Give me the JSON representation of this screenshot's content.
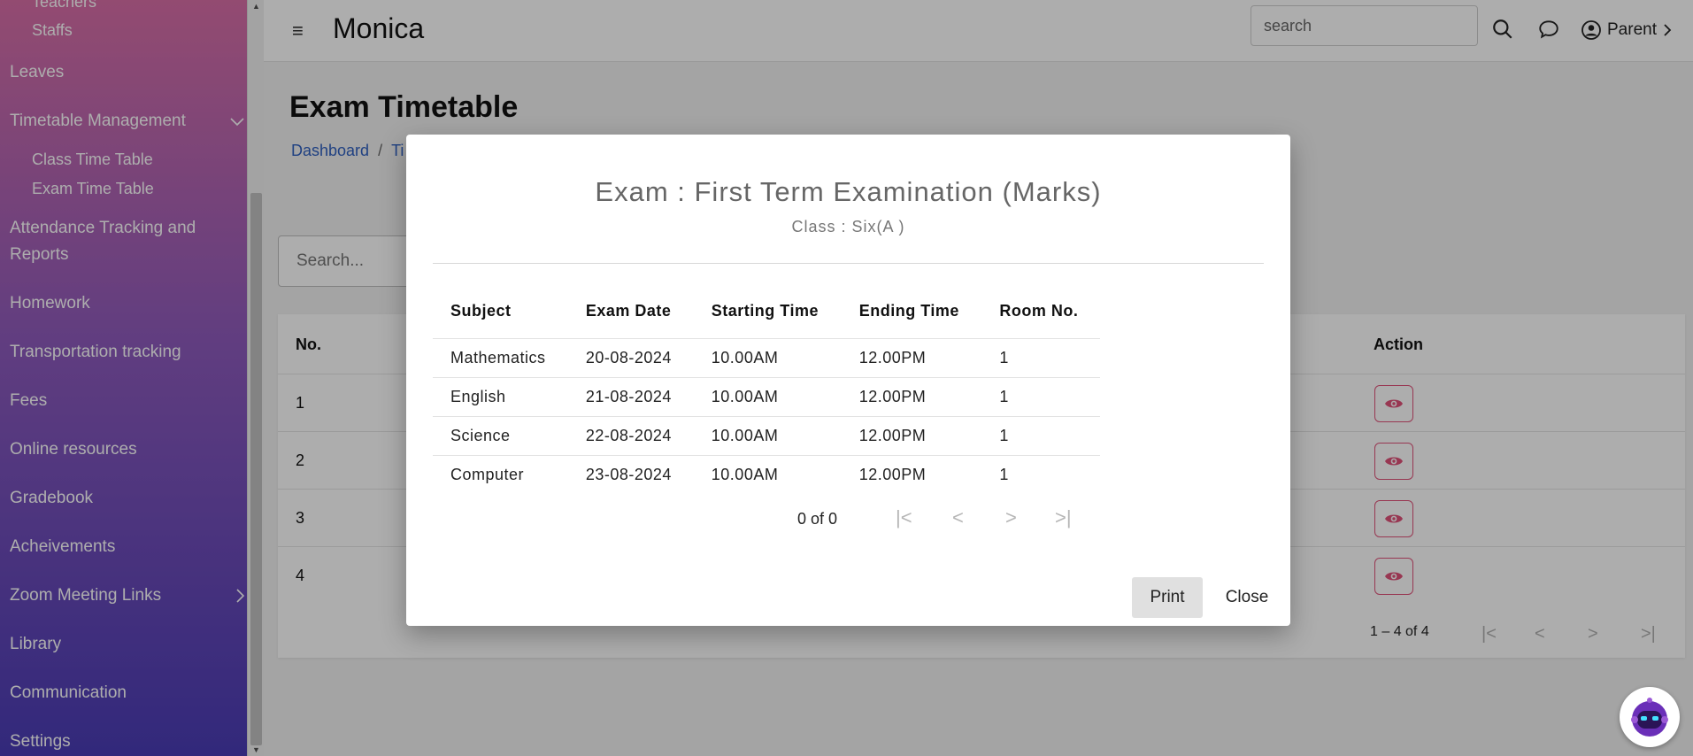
{
  "sidebar": {
    "items": [
      {
        "label": "Teachers"
      },
      {
        "label": "Staffs"
      },
      {
        "label": "Leaves"
      },
      {
        "label": "Timetable Management"
      },
      {
        "label": "Class Time Table"
      },
      {
        "label": "Exam Time Table"
      },
      {
        "label": "Attendance Tracking and Reports"
      },
      {
        "label": "Homework"
      },
      {
        "label": "Transportation tracking"
      },
      {
        "label": "Fees"
      },
      {
        "label": "Online resources"
      },
      {
        "label": "Gradebook"
      },
      {
        "label": "Acheivements"
      },
      {
        "label": "Zoom Meeting Links"
      },
      {
        "label": "Library"
      },
      {
        "label": "Communication"
      },
      {
        "label": "Settings"
      }
    ]
  },
  "header": {
    "app_title": "Monica",
    "search_placeholder": "search",
    "user_label": "Parent"
  },
  "page": {
    "title": "Exam Timetable",
    "breadcrumb": [
      "Dashboard",
      "Ti"
    ],
    "search_placeholder": "Search...",
    "table": {
      "col_no": "No.",
      "col_action": "Action",
      "rows": [
        "1",
        "2",
        "3",
        "4"
      ],
      "pager": "1 – 4 of 4"
    }
  },
  "modal": {
    "title": "Exam : First Term Examination (Marks)",
    "subtitle": "Class : Six(A )",
    "columns": [
      "Subject",
      "Exam Date",
      "Starting Time",
      "Ending Time",
      "Room No."
    ],
    "rows": [
      [
        "Mathematics",
        "20-08-2024",
        "10.00AM",
        "12.00PM",
        "1"
      ],
      [
        "English",
        "21-08-2024",
        "10.00AM",
        "12.00PM",
        "1"
      ],
      [
        "Science",
        "22-08-2024",
        "10.00AM",
        "12.00PM",
        "1"
      ],
      [
        "Computer",
        "23-08-2024",
        "10.00AM",
        "12.00PM",
        "1"
      ]
    ],
    "pager": "0 of 0",
    "print_label": "Print",
    "close_label": "Close"
  },
  "colors": {
    "accent": "#e0527a",
    "link": "#3060c0"
  },
  "icons": [
    "menu-icon",
    "search-icon",
    "chat-icon",
    "user-circle-icon",
    "eye-icon",
    "chatbot-icon"
  ]
}
